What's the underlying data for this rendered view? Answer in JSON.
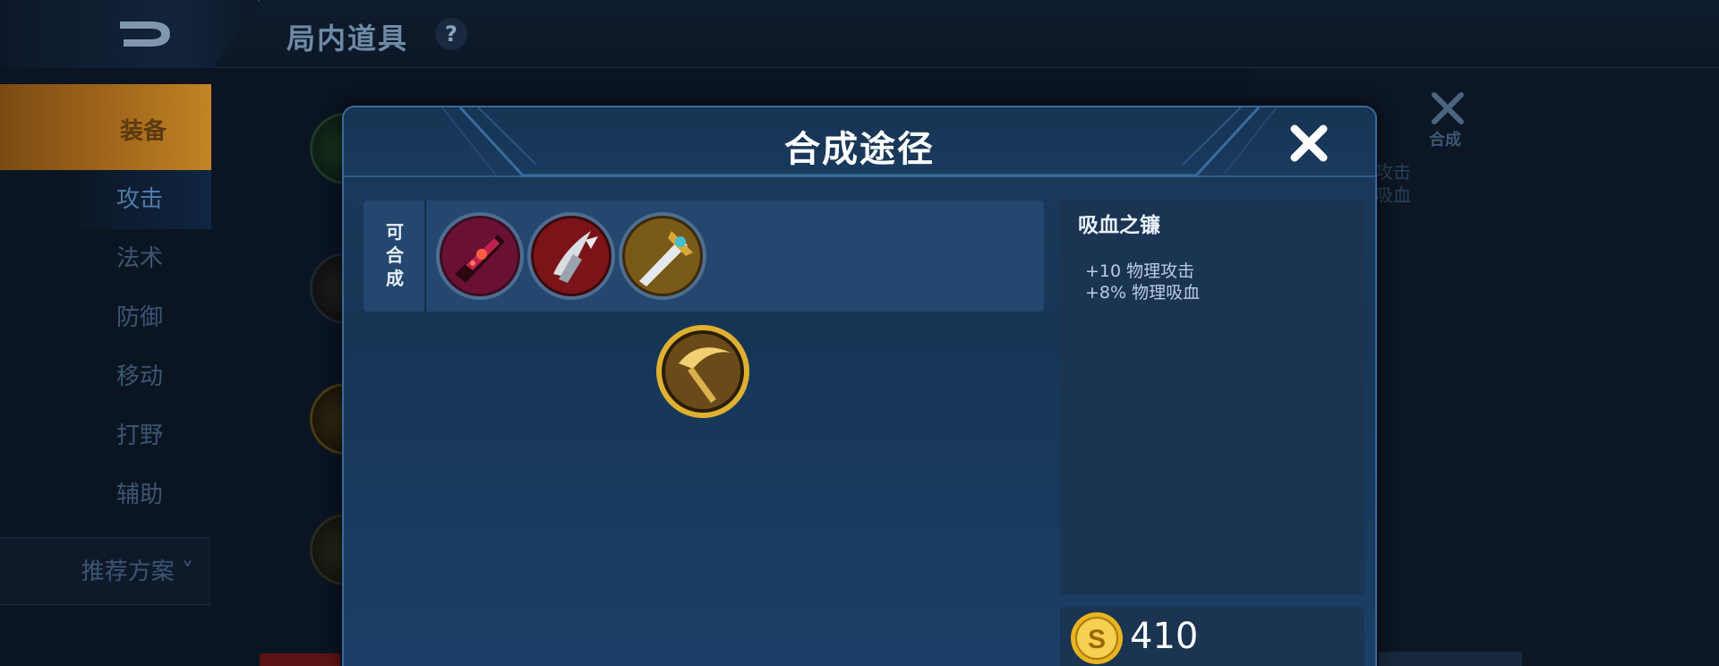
{
  "topbar": {
    "title": "局内道具",
    "help_label": "?"
  },
  "sidebar": {
    "equip_tab": "装备",
    "categories": [
      "攻击",
      "法术",
      "防御",
      "移动",
      "打野",
      "辅助"
    ],
    "recommend": "推荐方案"
  },
  "background_panel": {
    "merge_label": "合成",
    "text_1": "攻击",
    "text_2": "吸血"
  },
  "modal": {
    "title": "合成途径",
    "close_icon": "close-x-icon",
    "recipe_label": [
      "可",
      "合",
      "成"
    ],
    "recipe_items": [
      {
        "icon": "red-blade-item-icon"
      },
      {
        "icon": "silver-claw-item-icon"
      },
      {
        "icon": "golden-sword-item-icon"
      }
    ],
    "current_item_icon": "scythe-item-icon",
    "item": {
      "name": "吸血之镰",
      "stats": [
        "+10 物理攻击",
        "+8% 物理吸血"
      ],
      "price": "410",
      "price_icon": "gold-coin-icon"
    }
  },
  "colors": {
    "accent_gold": "#c28424",
    "modal_bg": "#1b3a5c",
    "panel_bg": "#1a3452"
  }
}
